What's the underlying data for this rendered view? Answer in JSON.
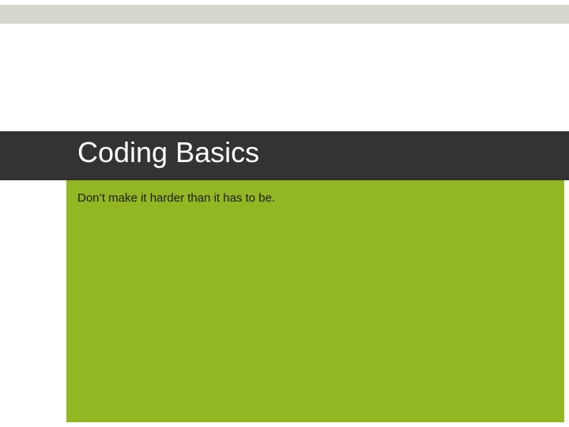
{
  "slide": {
    "title": "Coding Basics",
    "subtitle": "Don’t make it harder than it has to be."
  }
}
